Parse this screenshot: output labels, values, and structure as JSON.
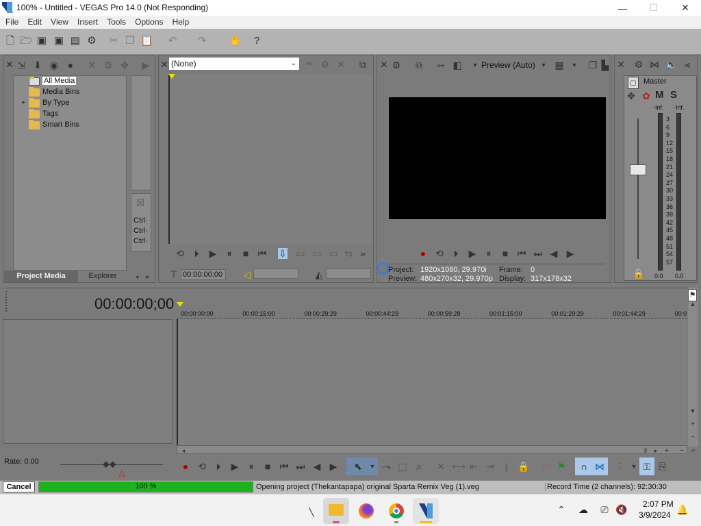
{
  "window": {
    "title": "100% - Untitled - VEGAS Pro 14.0 (Not Responding)",
    "minimize": "—",
    "maximize": "☐",
    "close": "✕"
  },
  "menu": [
    "File",
    "Edit",
    "View",
    "Insert",
    "Tools",
    "Options",
    "Help"
  ],
  "media": {
    "tree": [
      {
        "label": "All Media",
        "selected": true
      },
      {
        "label": "Media Bins"
      },
      {
        "label": "By Type",
        "expandable": true
      },
      {
        "label": "Tags"
      },
      {
        "label": "Smart Bins"
      }
    ],
    "side_shortcuts": [
      "Ctrl·",
      "Ctrl·",
      "Ctrl·"
    ],
    "tabs": {
      "project_media": "Project Media",
      "explorer": "Explorer"
    }
  },
  "trimmer": {
    "selector_value": "(None)",
    "time": "00:00:00;00"
  },
  "preview": {
    "quality": "Preview (Auto)",
    "project_label": "Project:",
    "project_value": "1920x1080, 29.970i",
    "preview_label": "Preview:",
    "preview_value": "480x270x32, 29.970p",
    "frame_label": "Frame:",
    "frame_value": "0",
    "display_label": "Display:",
    "display_value": "317x178x32"
  },
  "mixer": {
    "title": "Master",
    "m": "M",
    "s": "S",
    "inf_left": "-Inf.",
    "inf_right": "-Inf.",
    "scale": [
      "3",
      "6",
      "9",
      "12",
      "15",
      "18",
      "21",
      "24",
      "27",
      "30",
      "33",
      "36",
      "39",
      "42",
      "45",
      "48",
      "51",
      "54",
      "57"
    ],
    "left_value": "0.0",
    "right_value": "0.0"
  },
  "timeline": {
    "timecode": "00:00:00;00",
    "ruler": [
      "00:00:00:00",
      "00:00:15:00",
      "00:00:29:29",
      "00:00:44:29",
      "00:00:59:28",
      "00:01:15:00",
      "00:01:29:29",
      "00:01:44:29",
      "00:0"
    ],
    "rate": "Rate: 0.00"
  },
  "status": {
    "cancel": "Cancel",
    "progress_percent": 100,
    "progress_text": "100 %",
    "message": "Opening project (Thekantapapa) original Sparta Remix Veg (1).veg",
    "record_time": "Record Time (2 channels): 92:30:30"
  },
  "taskbar": {
    "time": "2:07 PM",
    "date": "3/9/2024"
  },
  "colors": {
    "progress": "#1db31d",
    "panel": "#7b7b7b"
  }
}
